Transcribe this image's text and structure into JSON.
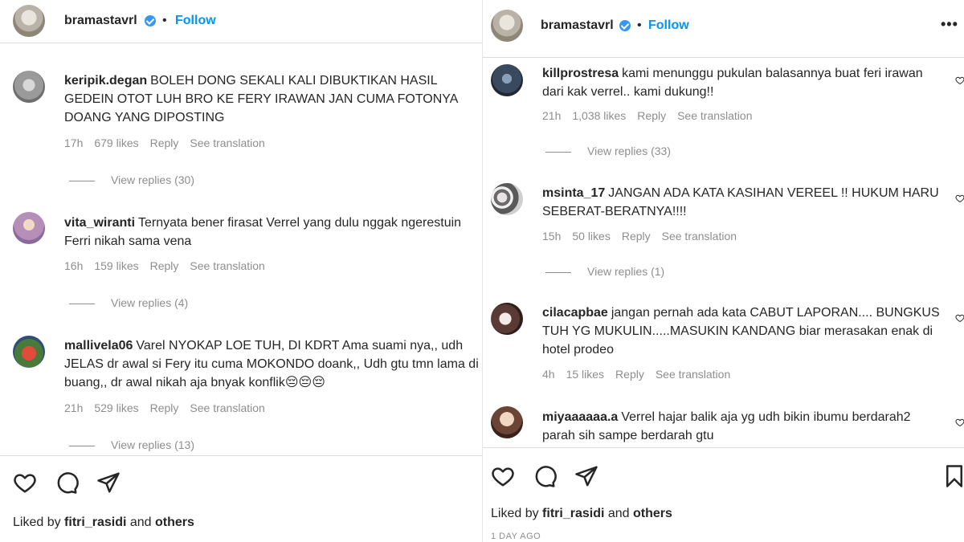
{
  "left": {
    "header": {
      "username": "bramastavrl",
      "separator": "•",
      "follow_label": "Follow"
    },
    "comments": [
      {
        "user": "keripik.degan",
        "text": "BOLEH DONG SEKALI KALI DIBUKTIKAN HASIL GEDEIN OTOT LUH BRO KE FERY IRAWAN JAN CUMA FOTONYA DOANG YANG DIPOSTING",
        "time": "17h",
        "likes": "679 likes",
        "reply": "Reply",
        "translate": "See translation",
        "replies": "View replies (30)"
      },
      {
        "user": "vita_wiranti",
        "text": "Ternyata bener firasat Verrel yang dulu nggak ngerestuin Ferri nikah sama vena",
        "time": "16h",
        "likes": "159 likes",
        "reply": "Reply",
        "translate": "See translation",
        "replies": "View replies (4)"
      },
      {
        "user": "mallivela06",
        "text": "Varel NYOKAP LOE TUH, DI KDRT Ama suami nya,, udh JELAS dr awal si Fery itu cuma MOKONDO doank,, Udh gtu tmn lama di buang,, dr awal nikah aja bnyak konflik😔😔😔",
        "time": "21h",
        "likes": "529 likes",
        "reply": "Reply",
        "translate": "See translation",
        "replies": "View replies (13)"
      }
    ],
    "liked_by": {
      "prefix": "Liked by",
      "user": "fitri_rasidi",
      "and": "and",
      "others": "others"
    }
  },
  "right": {
    "header": {
      "username": "bramastavrl",
      "separator": "•",
      "follow_label": "Follow",
      "more": "•••"
    },
    "comments": [
      {
        "user": "killprostresa",
        "text": "kami menunggu pukulan balasannya buat feri irawan dari kak verrel.. kami dukung!!",
        "time": "21h",
        "likes": "1,038 likes",
        "reply": "Reply",
        "translate": "See translation",
        "replies": "View replies (33)"
      },
      {
        "user": "msinta_17",
        "text": "JANGAN ADA KATA KASIHAN VEREEL !! HUKUM HARU SEBERAT-BERATNYA!!!!",
        "time": "15h",
        "likes": "50 likes",
        "reply": "Reply",
        "translate": "See translation",
        "replies": "View replies (1)"
      },
      {
        "user": "cilacapbae",
        "text": "jangan pernah ada kata CABUT LAPORAN.... BUNGKUS TUH YG MUKULIN.....MASUKIN KANDANG biar merasakan enak di hotel prodeo",
        "time": "4h",
        "likes": "15 likes",
        "reply": "Reply",
        "translate": "See translation"
      },
      {
        "user": "miyaaaaaa.a",
        "text": "Verrel hajar balik aja yg udh bikin ibumu berdarah2 parah sih sampe berdarah gtu"
      }
    ],
    "liked_by": {
      "prefix": "Liked by",
      "user": "fitri_rasidi",
      "and": "and",
      "others": "others"
    },
    "posted_ago": "1 DAY AGO"
  },
  "icons": {
    "heart": "heart-icon",
    "comment": "comment-icon",
    "share": "share-icon",
    "save": "bookmark-icon",
    "verified": "verified-badge-icon"
  }
}
